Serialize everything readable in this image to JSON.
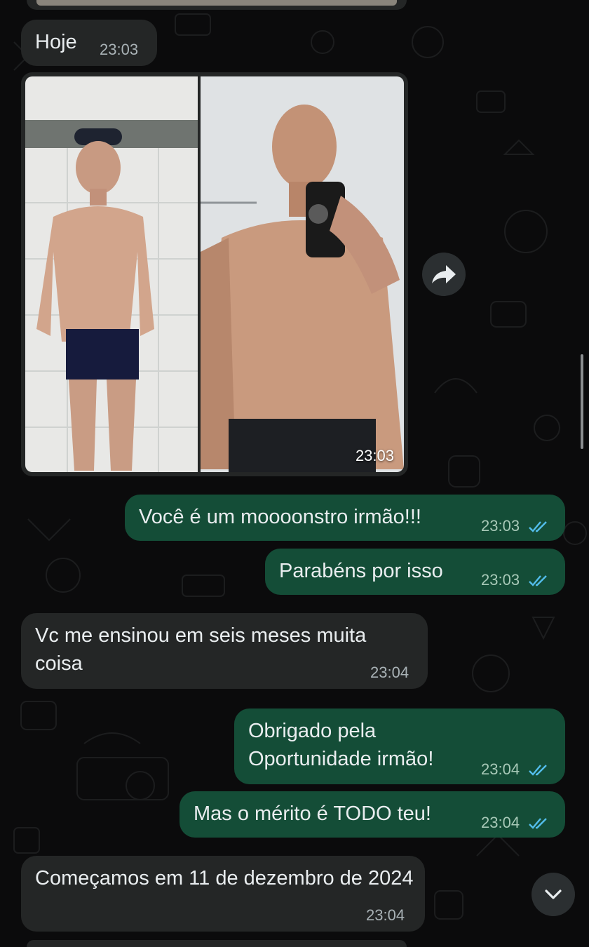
{
  "colors": {
    "incoming_bubble": "#242626",
    "outgoing_bubble": "#144d37",
    "read_ticks": "#53bdeb",
    "background": "#0b0b0c"
  },
  "chat": {
    "day_bubble": {
      "text": "Hoje",
      "time": "23:03"
    },
    "photo_message": {
      "time": "23:03",
      "forward_icon": "forward-arrow-icon",
      "description": "before-and-after"
    },
    "messages": [
      {
        "direction": "out",
        "text": "Você é um moooonstro irmão!!!",
        "time": "23:03",
        "status": "read"
      },
      {
        "direction": "out",
        "text": "Parabéns por isso",
        "time": "23:03",
        "status": "read"
      },
      {
        "direction": "in",
        "text": "Vc me ensinou em seis meses muita coisa",
        "time": "23:04"
      },
      {
        "direction": "out",
        "text": "Obrigado pela Oportunidade irmão!",
        "time": "23:04",
        "status": "read"
      },
      {
        "direction": "out",
        "text": "Mas o mérito é TODO teu!",
        "time": "23:04",
        "status": "read"
      },
      {
        "direction": "in",
        "text": "Começamos em 11 de dezembro de 2024",
        "time": "23:04"
      }
    ]
  },
  "controls": {
    "scroll_down_icon": "chevron-down-icon"
  }
}
